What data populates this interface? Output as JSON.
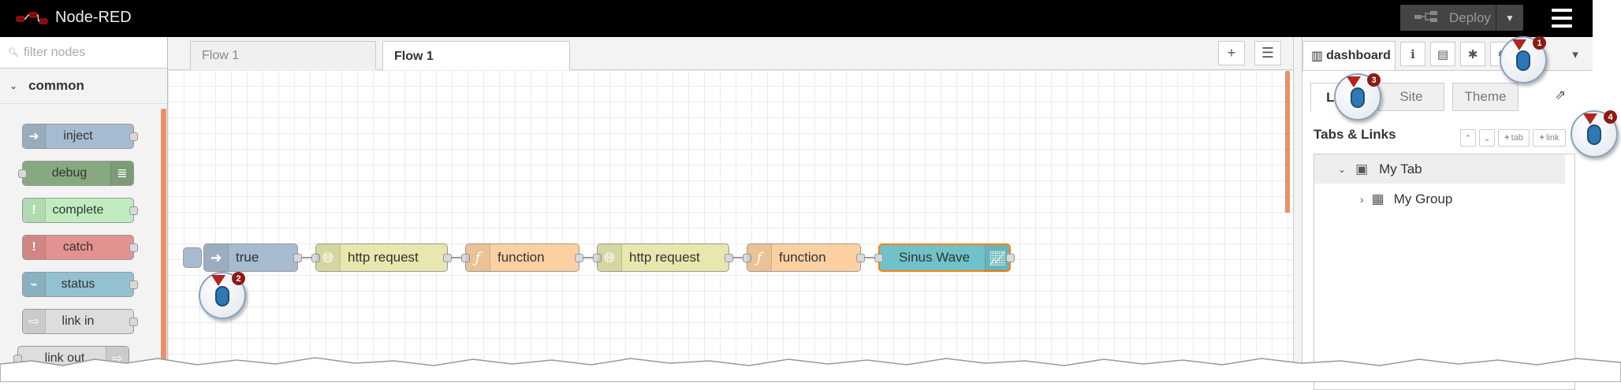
{
  "app": {
    "title": "Node-RED"
  },
  "header": {
    "deploy_label": "Deploy"
  },
  "palette": {
    "search_placeholder": "filter nodes",
    "category": "common",
    "nodes": [
      {
        "label": "inject",
        "color": "#a6bbcf",
        "icon": "arrow-right-icon",
        "side": "left"
      },
      {
        "label": "debug",
        "color": "#87a980",
        "icon": "list-icon",
        "side": "right"
      },
      {
        "label": "complete",
        "color": "#c0edc0",
        "icon": "exclamation-icon",
        "side": "left"
      },
      {
        "label": "catch",
        "color": "#e49191",
        "icon": "exclamation-icon",
        "side": "left"
      },
      {
        "label": "status",
        "color": "#94c1d0",
        "icon": "pulse-icon",
        "side": "left"
      },
      {
        "label": "link in",
        "color": "#dddddd",
        "icon": "link-in-icon",
        "side": "left"
      },
      {
        "label": "link out",
        "color": "#dddddd",
        "icon": "link-out-icon",
        "side": "right"
      }
    ]
  },
  "workspace": {
    "tabs": [
      "Flow 1",
      "Flow 1"
    ],
    "flow_nodes": [
      {
        "label": "true",
        "color": "#a6bbcf",
        "icon": "arrow-right-icon"
      },
      {
        "label": "http request",
        "color": "#e7e7ae",
        "icon": "globe-icon"
      },
      {
        "label": "function",
        "color": "#fdd0a2",
        "icon": "function-icon"
      },
      {
        "label": "http request",
        "color": "#e7e7ae",
        "icon": "globe-icon"
      },
      {
        "label": "function",
        "color": "#fdd0a2",
        "icon": "function-icon"
      },
      {
        "label": "Sinus Wave",
        "color": "#6fc3c8",
        "icon": "chart-icon"
      }
    ]
  },
  "sidebar": {
    "active_tab": "dashboard",
    "subtabs": [
      "La",
      "Site",
      "Theme"
    ],
    "section_title": "Tabs & Links",
    "buttons": [
      "tab",
      "link"
    ],
    "tree": [
      {
        "label": "My Tab",
        "icon": "tab-icon"
      },
      {
        "label": "My Group",
        "icon": "table-icon"
      }
    ]
  },
  "annotations": [
    "1",
    "2",
    "3",
    "4"
  ]
}
